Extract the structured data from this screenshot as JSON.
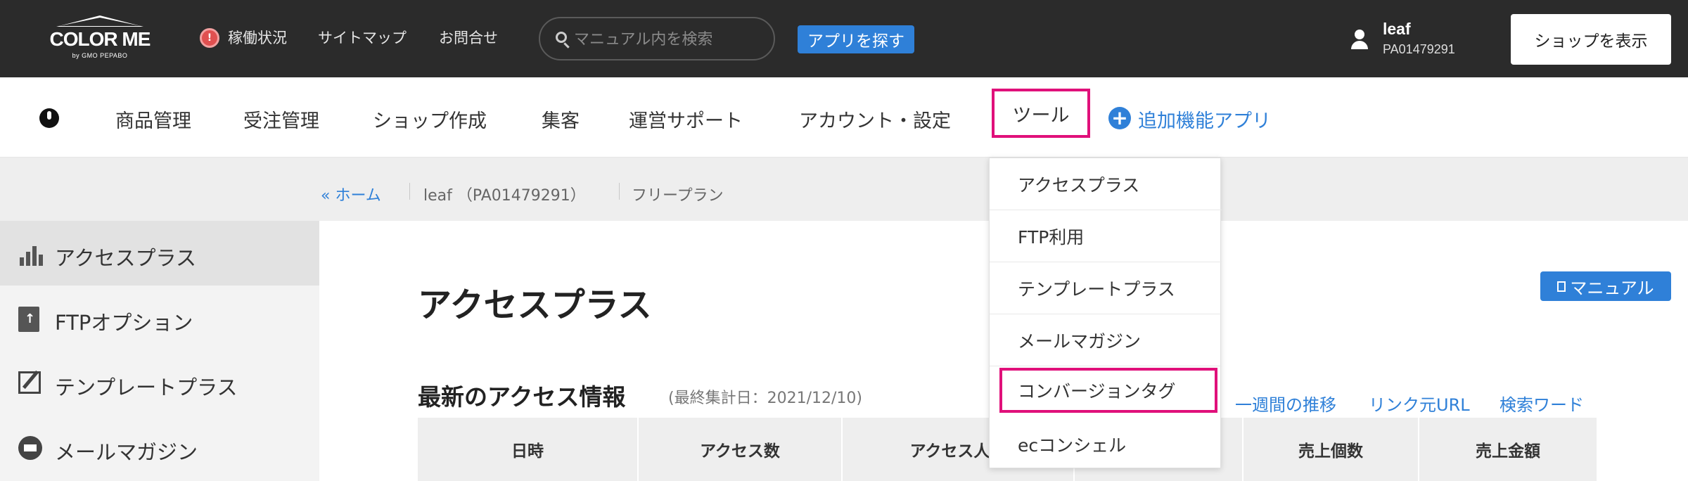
{
  "header": {
    "logo_text": "COLOR ME",
    "logo_sub": "by GMO PEPABO",
    "status_link": "稼働状況",
    "sitemap_link": "サイトマップ",
    "contact_link": "お問合せ",
    "search_placeholder": "マニュアル内を検索",
    "app_button": "アプリを探す",
    "user_name": "leaf",
    "user_id": "PA01479291",
    "shop_button": "ショップを表示"
  },
  "nav": {
    "items": [
      "商品管理",
      "受注管理",
      "ショップ作成",
      "集客",
      "運営サポート",
      "アカウント・設定"
    ],
    "tools": "ツール",
    "addon": "追加機能アプリ"
  },
  "breadcrumb": {
    "home": "« ホーム",
    "account": "leaf （PA01479291）",
    "plan": "フリープラン"
  },
  "sidebar": {
    "items": [
      {
        "label": "アクセスプラス",
        "icon": "chart-icon",
        "active": true
      },
      {
        "label": "FTPオプション",
        "icon": "file-upload-icon"
      },
      {
        "label": "テンプレートプラス",
        "icon": "edit-icon"
      },
      {
        "label": "メールマガジン",
        "icon": "mail-icon"
      }
    ]
  },
  "main": {
    "title": "アクセスプラス",
    "manual_button": "マニュアル",
    "section_title": "最新のアクセス情報",
    "section_sub": "(最終集計日：2021/12/10)",
    "links": [
      "一週間の推移",
      "リンク元URL",
      "検索ワード"
    ],
    "table_headers": [
      "日時",
      "アクセス数",
      "アクセス人数",
      "",
      "売上個数",
      "売上金額"
    ]
  },
  "dropdown": {
    "items": [
      "アクセスプラス",
      "FTP利用",
      "テンプレートプラス",
      "メールマガジン",
      "コンバージョンタグ",
      "ecコンシェル"
    ],
    "highlighted": "コンバージョンタグ"
  },
  "colors": {
    "topbar": "#2b2b2b",
    "accent": "#2f80d8",
    "highlight": "#e0107a"
  }
}
